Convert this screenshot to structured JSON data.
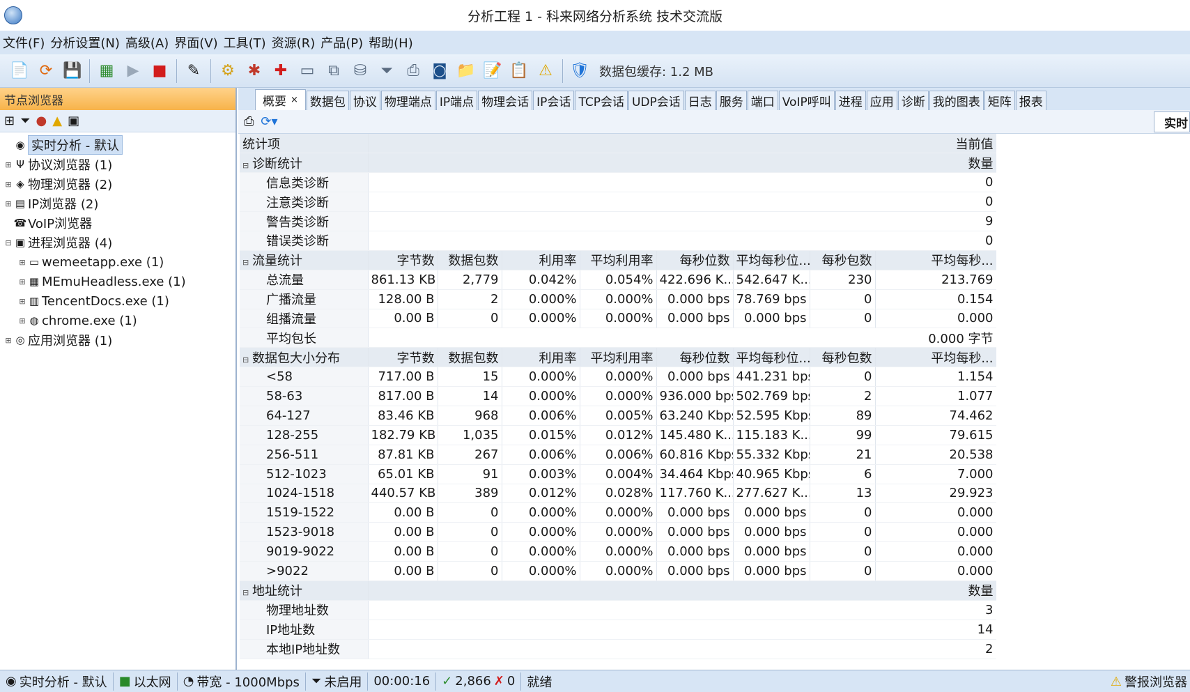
{
  "window": {
    "title": "分析工程 1 - 科来网络分析系统 技术交流版"
  },
  "menu": [
    "文件(F)",
    "分析设置(N)",
    "高级(A)",
    "界面(V)",
    "工具(T)",
    "资源(R)",
    "产品(P)",
    "帮助(H)"
  ],
  "toolbar": {
    "cache_label": "数据包缓存:  1.2 MB"
  },
  "left_panel": {
    "header": "节点浏览器",
    "tree": [
      {
        "label": "实时分析 - 默认",
        "icon": "realtime-icon",
        "glyph": "◉",
        "exp": "",
        "indent": 0,
        "selected": true
      },
      {
        "label": "协议浏览器 (1)",
        "icon": "protocol-icon",
        "glyph": "Ψ",
        "exp": "⊞",
        "indent": 0
      },
      {
        "label": "物理浏览器 (2)",
        "icon": "physical-icon",
        "glyph": "◈",
        "exp": "⊞",
        "indent": 0
      },
      {
        "label": "IP浏览器 (2)",
        "icon": "ip-icon",
        "glyph": "▤",
        "exp": "⊞",
        "indent": 0
      },
      {
        "label": "VoIP浏览器",
        "icon": "voip-icon",
        "glyph": "☎",
        "exp": "",
        "indent": 0
      },
      {
        "label": "进程浏览器 (4)",
        "icon": "process-icon",
        "glyph": "▣",
        "exp": "⊟",
        "indent": 0
      },
      {
        "label": "wemeetapp.exe (1)",
        "icon": "wemeet-icon",
        "glyph": "▭",
        "exp": "⊞",
        "indent": 1
      },
      {
        "label": "MEmuHeadless.exe (1)",
        "icon": "memu-icon",
        "glyph": "▦",
        "exp": "⊞",
        "indent": 1
      },
      {
        "label": "TencentDocs.exe (1)",
        "icon": "tencentdocs-icon",
        "glyph": "▥",
        "exp": "⊞",
        "indent": 1
      },
      {
        "label": "chrome.exe (1)",
        "icon": "chrome-icon",
        "glyph": "◍",
        "exp": "⊞",
        "indent": 1
      },
      {
        "label": "应用浏览器 (1)",
        "icon": "app-icon",
        "glyph": "◎",
        "exp": "⊞",
        "indent": 0
      }
    ]
  },
  "tabs": [
    "概要",
    "数据包",
    "协议",
    "物理端点",
    "IP端点",
    "物理会话",
    "IP会话",
    "TCP会话",
    "UDP会话",
    "日志",
    "服务",
    "端口",
    "VoIP呼叫",
    "进程",
    "应用",
    "诊断",
    "我的图表",
    "矩阵",
    "报表"
  ],
  "realtime_button": "实时",
  "stats": {
    "col_item": "统计项",
    "col_current": "当前值",
    "diag": {
      "title": "诊断统计",
      "value_header": "数量",
      "rows": [
        {
          "name": "信息类诊断",
          "value": "0"
        },
        {
          "name": "注意类诊断",
          "value": "0"
        },
        {
          "name": "警告类诊断",
          "value": "9"
        },
        {
          "name": "错误类诊断",
          "value": "0"
        }
      ]
    },
    "traffic": {
      "title": "流量统计",
      "headers": [
        "字节数",
        "数据包数",
        "利用率",
        "平均利用率",
        "每秒位数",
        "平均每秒位...",
        "每秒包数",
        "平均每秒..."
      ],
      "rows": [
        {
          "name": "总流量",
          "cells": [
            "861.13 KB",
            "2,779",
            "0.042%",
            "0.054%",
            "422.696 K...",
            "542.647 K...",
            "230",
            "213.769"
          ]
        },
        {
          "name": "广播流量",
          "cells": [
            "128.00 B",
            "2",
            "0.000%",
            "0.000%",
            "0.000 bps",
            "78.769 bps",
            "0",
            "0.154"
          ]
        },
        {
          "name": "组播流量",
          "cells": [
            "0.00 B",
            "0",
            "0.000%",
            "0.000%",
            "0.000 bps",
            "0.000 bps",
            "0",
            "0.000"
          ]
        }
      ],
      "avg_name": "平均包长",
      "avg_value": "0.000 字节"
    },
    "size": {
      "title": "数据包大小分布",
      "headers": [
        "字节数",
        "数据包数",
        "利用率",
        "平均利用率",
        "每秒位数",
        "平均每秒位...",
        "每秒包数",
        "平均每秒..."
      ],
      "rows": [
        {
          "name": "<58",
          "cells": [
            "717.00 B",
            "15",
            "0.000%",
            "0.000%",
            "0.000 bps",
            "441.231 bps",
            "0",
            "1.154"
          ]
        },
        {
          "name": "58-63",
          "cells": [
            "817.00 B",
            "14",
            "0.000%",
            "0.000%",
            "936.000 bps",
            "502.769 bps",
            "2",
            "1.077"
          ]
        },
        {
          "name": "64-127",
          "cells": [
            "83.46 KB",
            "968",
            "0.006%",
            "0.005%",
            "63.240 Kbps",
            "52.595 Kbps",
            "89",
            "74.462"
          ]
        },
        {
          "name": "128-255",
          "cells": [
            "182.79 KB",
            "1,035",
            "0.015%",
            "0.012%",
            "145.480 K...",
            "115.183 K...",
            "99",
            "79.615"
          ]
        },
        {
          "name": "256-511",
          "cells": [
            "87.81 KB",
            "267",
            "0.006%",
            "0.006%",
            "60.816 Kbps",
            "55.332 Kbps",
            "21",
            "20.538"
          ]
        },
        {
          "name": "512-1023",
          "cells": [
            "65.01 KB",
            "91",
            "0.003%",
            "0.004%",
            "34.464 Kbps",
            "40.965 Kbps",
            "6",
            "7.000"
          ]
        },
        {
          "name": "1024-1518",
          "cells": [
            "440.57 KB",
            "389",
            "0.012%",
            "0.028%",
            "117.760 K...",
            "277.627 K...",
            "13",
            "29.923"
          ]
        },
        {
          "name": "1519-1522",
          "cells": [
            "0.00 B",
            "0",
            "0.000%",
            "0.000%",
            "0.000 bps",
            "0.000 bps",
            "0",
            "0.000"
          ]
        },
        {
          "name": "1523-9018",
          "cells": [
            "0.00 B",
            "0",
            "0.000%",
            "0.000%",
            "0.000 bps",
            "0.000 bps",
            "0",
            "0.000"
          ]
        },
        {
          "name": "9019-9022",
          "cells": [
            "0.00 B",
            "0",
            "0.000%",
            "0.000%",
            "0.000 bps",
            "0.000 bps",
            "0",
            "0.000"
          ]
        },
        {
          "name": ">9022",
          "cells": [
            "0.00 B",
            "0",
            "0.000%",
            "0.000%",
            "0.000 bps",
            "0.000 bps",
            "0",
            "0.000"
          ]
        }
      ]
    },
    "addr": {
      "title": "地址统计",
      "value_header": "数量",
      "rows": [
        {
          "name": "物理地址数",
          "value": "3"
        },
        {
          "name": "IP地址数",
          "value": "14"
        },
        {
          "name": "本地IP地址数",
          "value": "2"
        }
      ]
    }
  },
  "statusbar": {
    "profile": "实时分析 - 默认",
    "adapter": "以太网",
    "bandwidth": "带宽 - 1000Mbps",
    "filter": "未启用",
    "elapsed": "00:00:16",
    "packets": "2,866",
    "dropped": "0",
    "state": "就绪",
    "alert_browser": "警报浏览器"
  }
}
